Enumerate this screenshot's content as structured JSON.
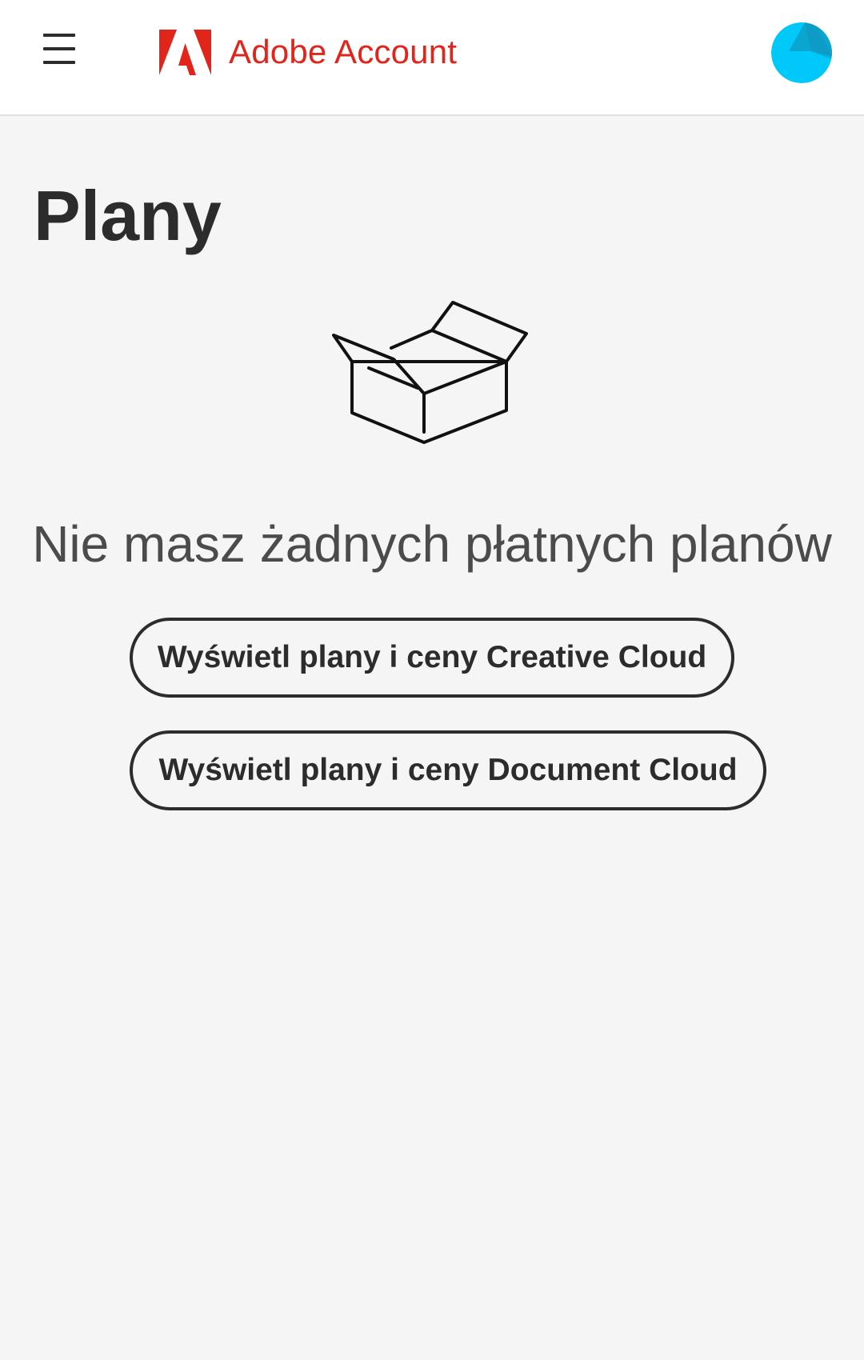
{
  "header": {
    "brand_name": "Adobe Account",
    "brand_color": "#e1251b",
    "menu_icon": "hamburger-menu-icon",
    "logo_icon": "adobe-logo-icon",
    "avatar_color": "#00c8f8"
  },
  "main": {
    "title": "Plany",
    "illustration_icon": "empty-box-icon",
    "empty_message": "Nie masz żadnych płatnych planów",
    "buttons": {
      "creative_cloud": "Wyświetl plany i ceny Creative Cloud",
      "document_cloud": "Wyświetl plany i ceny Document Cloud"
    }
  }
}
